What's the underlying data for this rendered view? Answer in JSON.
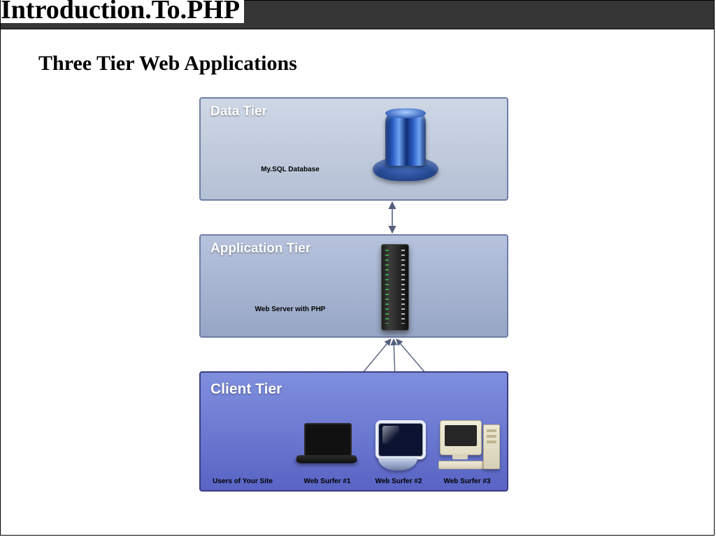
{
  "header": {
    "title": "Introduction.To.PHP"
  },
  "subtitle": "Three Tier Web Applications",
  "tiers": {
    "data": {
      "title": "Data Tier",
      "caption": "My.SQL Database"
    },
    "app": {
      "title": "Application Tier",
      "caption": "Web Server with PHP"
    },
    "client": {
      "title": "Client Tier",
      "caption_users": "Users of Your Site",
      "clients": [
        "Web Surfer #1",
        "Web Surfer #2",
        "Web Surfer #3"
      ]
    }
  }
}
